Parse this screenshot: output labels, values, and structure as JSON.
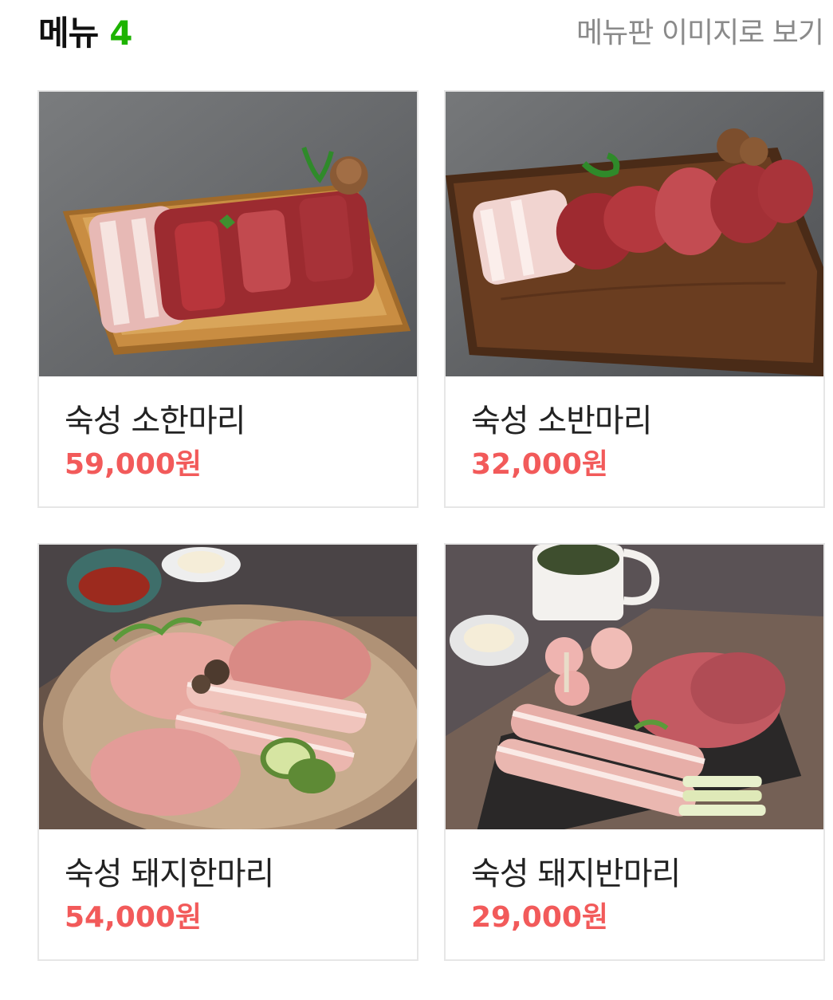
{
  "header": {
    "title": "메뉴",
    "count": "4",
    "view_as_image_label": "메뉴판 이미지로 보기"
  },
  "menu_items": [
    {
      "name": "숙성 소한마리",
      "price": "59,000원",
      "photo_icon": "beef-platter-photo"
    },
    {
      "name": "숙성 소반마리",
      "price": "32,000원",
      "photo_icon": "beef-board-photo"
    },
    {
      "name": "숙성 돼지한마리",
      "price": "54,000원",
      "photo_icon": "pork-plate-photo"
    },
    {
      "name": "숙성 돼지반마리",
      "price": "29,000원",
      "photo_icon": "pork-slate-photo"
    }
  ],
  "colors": {
    "accent_green": "#1db300",
    "price_red": "#f25a5a",
    "muted_text": "#8a8a8a"
  }
}
